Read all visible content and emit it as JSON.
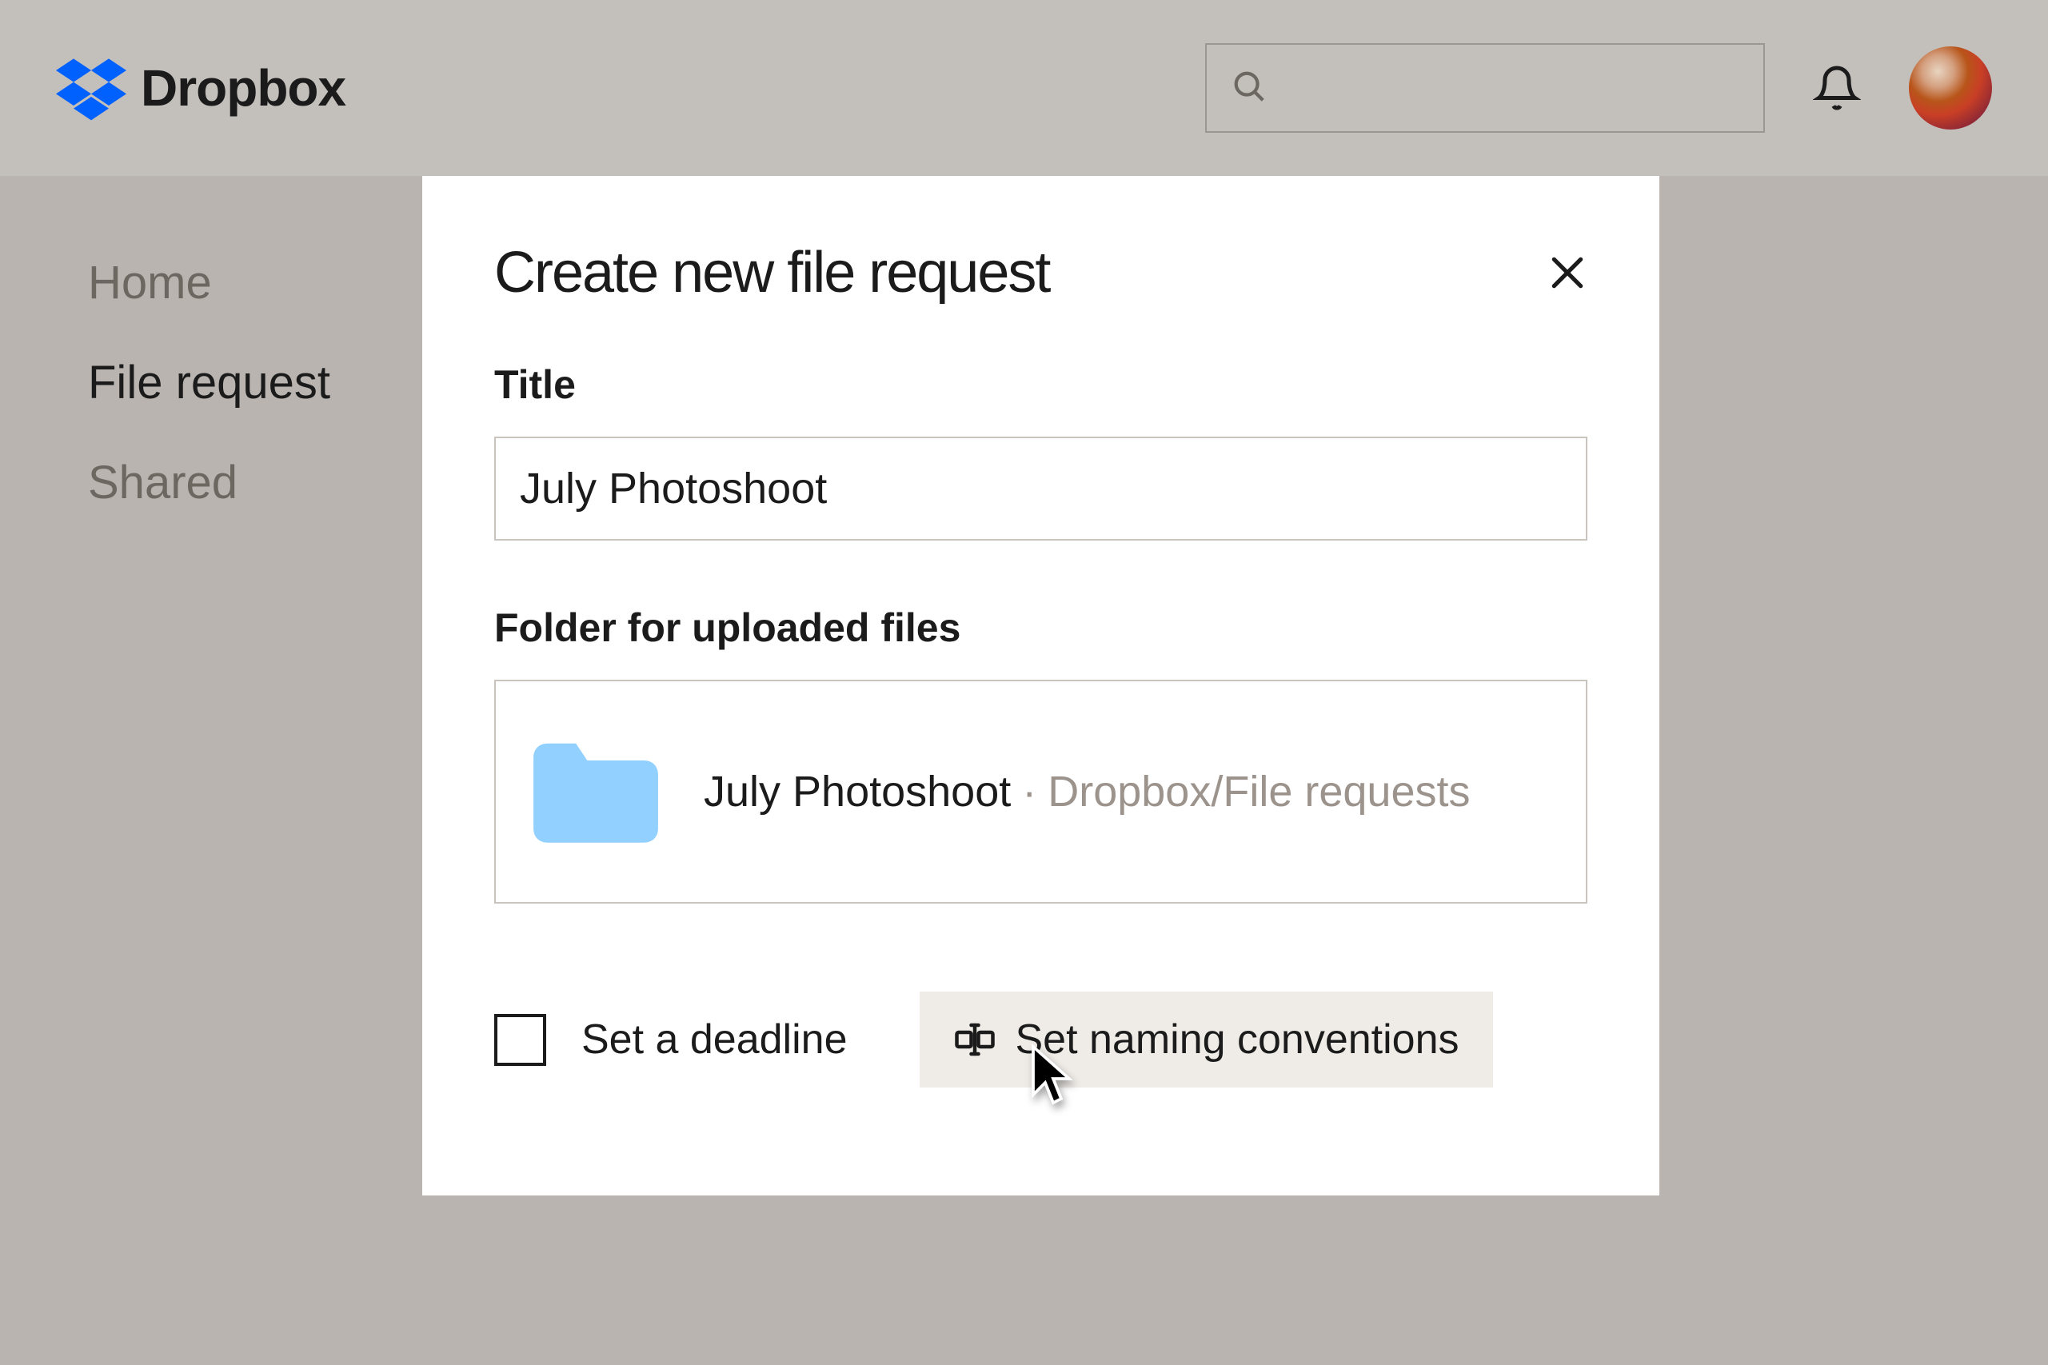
{
  "brand": {
    "name": "Dropbox"
  },
  "sidebar": {
    "items": [
      {
        "label": "Home",
        "active": false
      },
      {
        "label": "File request",
        "active": true
      },
      {
        "label": "Shared",
        "active": false
      }
    ]
  },
  "modal": {
    "title": "Create new file request",
    "title_label": "Title",
    "title_value": "July Photoshoot",
    "folder_label": "Folder for uploaded files",
    "folder_name": "July Photoshoot",
    "folder_path": "Dropbox/File requests",
    "deadline_label": "Set a deadline",
    "naming_label": "Set naming conventions"
  }
}
